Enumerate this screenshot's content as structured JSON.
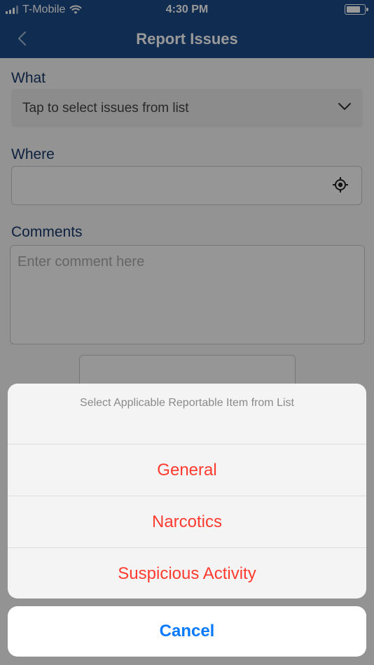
{
  "status_bar": {
    "carrier": "T-Mobile",
    "time": "4:30 PM"
  },
  "nav": {
    "title": "Report Issues"
  },
  "form": {
    "what_label": "What",
    "what_placeholder": "Tap to select issues from list",
    "where_label": "Where",
    "comments_label": "Comments",
    "comments_placeholder": "Enter comment here"
  },
  "action_sheet": {
    "title": "Select Applicable Reportable Item from List",
    "options": [
      "General",
      "Narcotics",
      "Suspicious Activity"
    ],
    "cancel": "Cancel"
  },
  "colors": {
    "nav_bg": "#1c4a85",
    "label_color": "#17386a",
    "destructive": "#ff3b30",
    "cancel_blue": "#0a7aff"
  }
}
